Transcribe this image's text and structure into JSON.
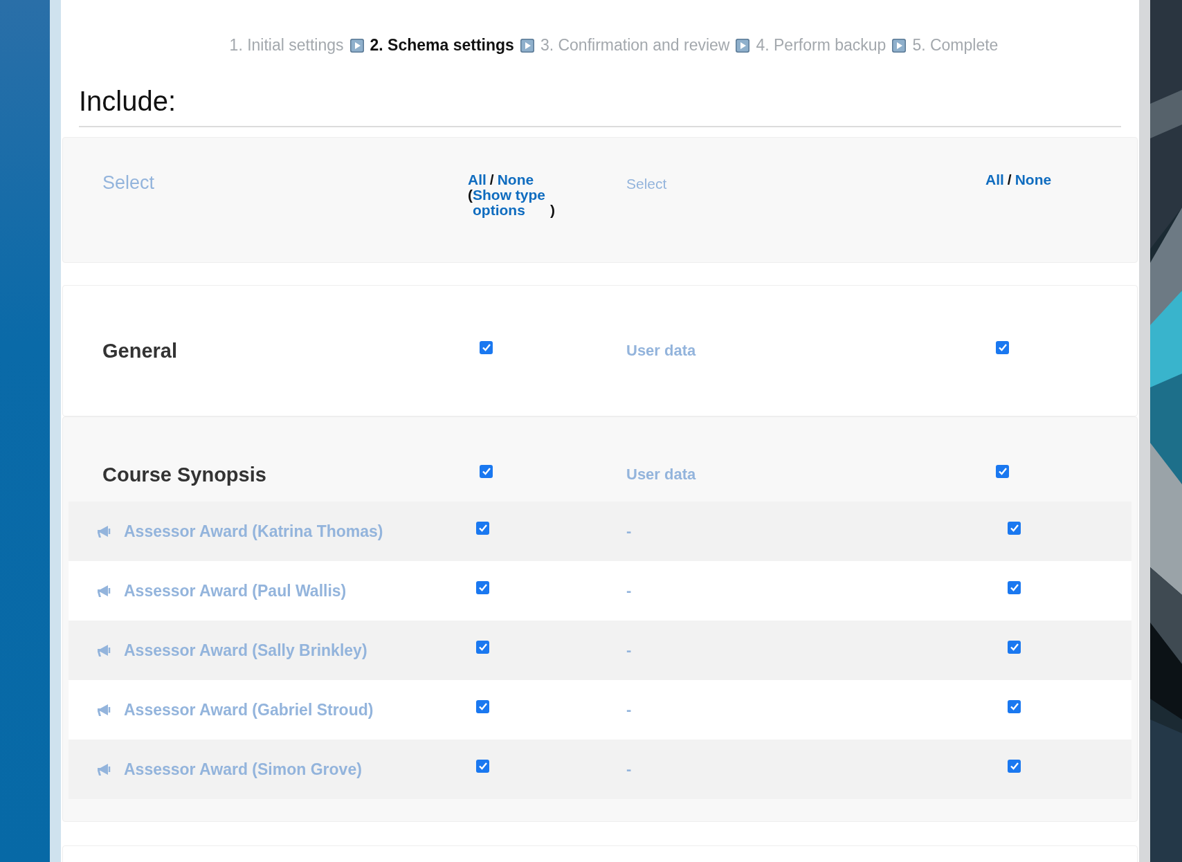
{
  "breadcrumb": [
    {
      "label": "1. Initial settings",
      "selected": false
    },
    {
      "label": "2. Schema settings",
      "selected": true
    },
    {
      "label": "3. Confirmation and review",
      "selected": false
    },
    {
      "label": "4. Perform backup",
      "selected": false
    },
    {
      "label": "5. Complete",
      "selected": false
    }
  ],
  "heading": "Include:",
  "header": {
    "column_1": "Select",
    "column_2": [
      {
        "kind": "link",
        "text": "All"
      },
      {
        "kind": "text",
        "text": "/"
      },
      {
        "kind": "link",
        "text": "None"
      },
      {
        "kind": "break"
      },
      {
        "kind": "text",
        "text": "("
      },
      {
        "kind": "link",
        "text": "Show type options"
      },
      {
        "kind": "text",
        "text": ")"
      }
    ],
    "column_3": "Select",
    "column_4": [
      {
        "kind": "link",
        "text": "All"
      },
      {
        "kind": "text",
        "text": "/"
      },
      {
        "kind": "link",
        "text": "None"
      }
    ]
  },
  "sections": [
    {
      "title": "General",
      "checked": true,
      "user_data": "User data",
      "user_data_checked": true
    },
    {
      "title": "Course Synopsis",
      "checked": true,
      "user_data": "User data",
      "user_data_checked": true,
      "items": [
        {
          "label": "Assessor Award (Katrina Thomas)",
          "checked": true,
          "user_data": "-",
          "user_data_checked": true
        },
        {
          "label": "Assessor Award (Paul Wallis)",
          "checked": true,
          "user_data": "-",
          "user_data_checked": true
        },
        {
          "label": "Assessor Award (Sally Brinkley)",
          "checked": true,
          "user_data": "-",
          "user_data_checked": true
        },
        {
          "label": "Assessor Award (Gabriel Stroud)",
          "checked": true,
          "user_data": "-",
          "user_data_checked": true
        },
        {
          "label": "Assessor Award (Simon Grove)",
          "checked": true,
          "user_data": "-",
          "user_data_checked": true
        }
      ]
    }
  ]
}
